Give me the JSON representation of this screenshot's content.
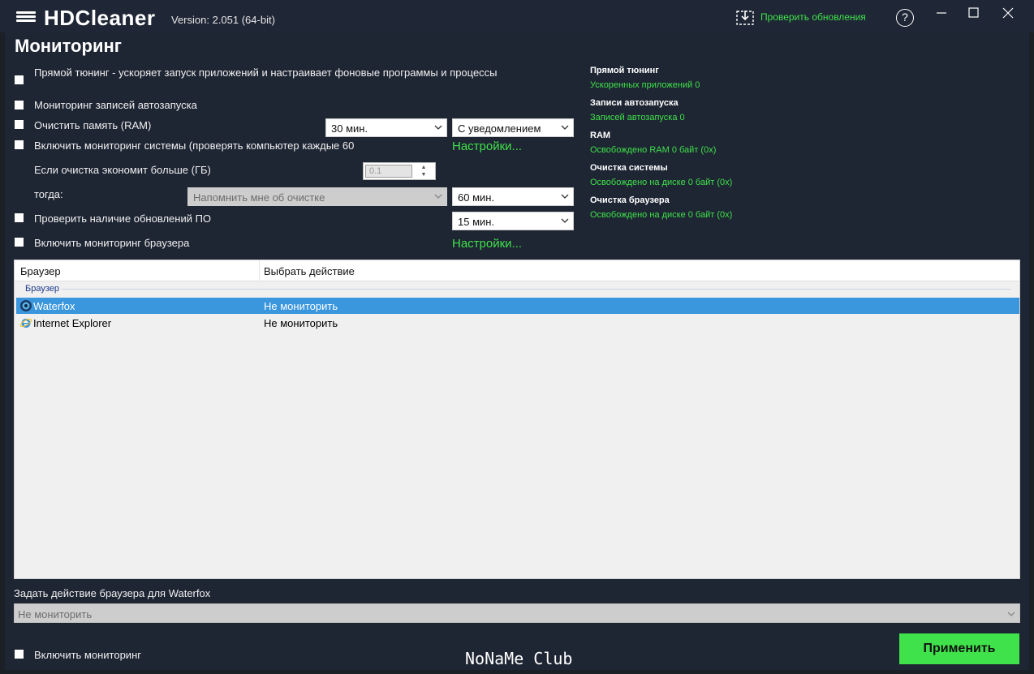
{
  "titlebar": {
    "app_name": "HDCleaner",
    "version": "Version: 2.051 (64-bit)",
    "update_link": "Проверить обновления",
    "help": "?"
  },
  "page_title": "Мониторинг",
  "options": {
    "direct_tuning": "Прямой тюнинг - ускоряет запуск приложений и настраивает фоновые программы и процессы",
    "autostart": "Мониторинг записей автозапуска",
    "clear_ram": "Очистить память (RAM)",
    "system_monitor": "Включить мониторинг системы (проверять компьютер каждые 60",
    "if_saves": "Если очистка экономит больше (ГБ)",
    "then": "тогда:",
    "check_updates": "Проверить наличие обновлений ПО",
    "browser_monitor": "Включить мониторинг браузера"
  },
  "controls": {
    "ram_interval": "30 мин.",
    "ram_notify": "С уведомлением",
    "system_settings": "Настройки...",
    "threshold": "0.1",
    "then_action": "Напомнить мне об очистке",
    "system_interval": "60 мин.",
    "update_interval": "15 мин.",
    "browser_settings": "Настройки..."
  },
  "stats": [
    {
      "title": "Прямой тюнинг",
      "value": "Ускоренных приложений 0"
    },
    {
      "title": "Записи автозапуска",
      "value": "Записей автозапуска 0"
    },
    {
      "title": "RAM",
      "value": "Освобождено RAM 0 байт (0x)"
    },
    {
      "title": "Очистка системы",
      "value": "Освобождено на диске 0 байт (0x)"
    },
    {
      "title": "Очистка браузера",
      "value": "Освобождено на диске 0 байт (0x)"
    }
  ],
  "table": {
    "col_browser": "Браузер",
    "col_action": "Выбрать действие",
    "group": "Браузер",
    "rows": [
      {
        "browser": "Waterfox",
        "action": "Не мониторить",
        "selected": true
      },
      {
        "browser": "Internet Explorer",
        "action": "Не мониторить",
        "selected": false
      }
    ]
  },
  "bottom": {
    "label": "Задать действие браузера для Waterfox",
    "action_value": "Не мониторить",
    "enable_monitoring": "Включить мониторинг",
    "watermark": "NoNaMe Club",
    "apply": "Применить"
  },
  "colors": {
    "accent_green": "#3fe24a",
    "background": "#1e2533",
    "selection": "#3a96dd"
  }
}
